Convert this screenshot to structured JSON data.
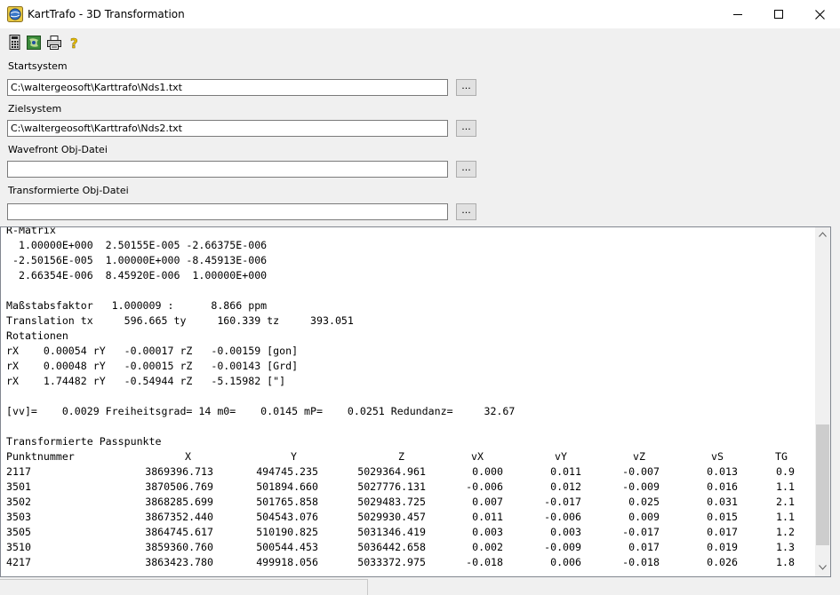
{
  "window": {
    "title": "KartTrafo - 3D Transformation"
  },
  "toolbar": {
    "icons": [
      "calculator-icon",
      "globe-icon",
      "printer-icon",
      "help-icon"
    ]
  },
  "form": {
    "start": {
      "label": "Startsystem",
      "value": "C:\\waltergeosoft\\Karttrafo\\Nds1.txt",
      "button": "..."
    },
    "ziel": {
      "label": "Zielsystem",
      "value": "C:\\waltergeosoft\\Karttrafo\\Nds2.txt",
      "button": "..."
    },
    "wavefront": {
      "label": "Wavefront Obj-Datei",
      "value": "",
      "button": "..."
    },
    "transformed": {
      "label": "Transformierte Obj-Datei",
      "value": "",
      "button": "..."
    }
  },
  "output": {
    "lines": [
      "R-Matrix",
      "  1.00000E+000  2.50155E-005 -2.66375E-006",
      " -2.50156E-005  1.00000E+000 -8.45913E-006",
      "  2.66354E-006  8.45920E-006  1.00000E+000",
      "",
      "Maßstabsfaktor   1.000009 :      8.866 ppm",
      "Translation tx     596.665 ty     160.339 tz     393.051",
      "Rotationen",
      "rX    0.00054 rY   -0.00017 rZ   -0.00159 [gon]",
      "rX    0.00048 rY   -0.00015 rZ   -0.00143 [Grd]",
      "rX    1.74482 rY   -0.54944 rZ   -5.15982 [\"]",
      "",
      "[vv]=    0.0029 Freiheitsgrad= 14 m0=    0.0145 mP=    0.0251 Redundanz=     32.67",
      "",
      "Transformierte Passpunkte"
    ],
    "table": {
      "headers": [
        "Punktnummer",
        "X",
        "Y",
        "Z",
        "vX",
        "vY",
        "vZ",
        "vS",
        "TG"
      ],
      "rows": [
        [
          "2117",
          "3869396.713",
          "494745.235",
          "5029364.961",
          "0.000",
          "0.011",
          "-0.007",
          "0.013",
          "0.9"
        ],
        [
          "3501",
          "3870506.769",
          "501894.660",
          "5027776.131",
          "-0.006",
          "0.012",
          "-0.009",
          "0.016",
          "1.1"
        ],
        [
          "3502",
          "3868285.699",
          "501765.858",
          "5029483.725",
          "0.007",
          "-0.017",
          "0.025",
          "0.031",
          "2.1"
        ],
        [
          "3503",
          "3867352.440",
          "504543.076",
          "5029930.457",
          "0.011",
          "-0.006",
          "0.009",
          "0.015",
          "1.1"
        ],
        [
          "3505",
          "3864745.617",
          "510190.825",
          "5031346.419",
          "0.003",
          "0.003",
          "-0.017",
          "0.017",
          "1.2"
        ],
        [
          "3510",
          "3859360.760",
          "500544.453",
          "5036442.658",
          "0.002",
          "-0.009",
          "0.017",
          "0.019",
          "1.3"
        ],
        [
          "4217",
          "3863423.780",
          "499918.056",
          "5033372.975",
          "-0.018",
          "0.006",
          "-0.018",
          "0.026",
          "1.8"
        ]
      ]
    }
  }
}
